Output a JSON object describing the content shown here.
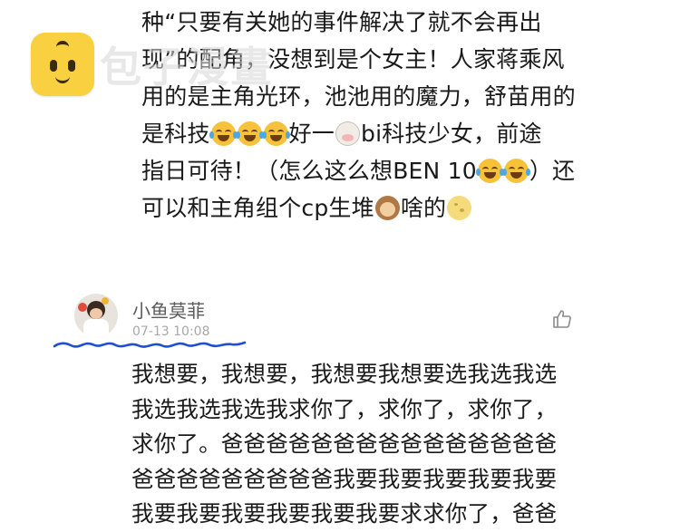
{
  "previous_comment": {
    "lines": [
      "种“只要有关她的事件解决了就不会再出",
      "现”的配角，没想到是个女主！人家蒋乘风",
      "用的是主角光环，池池用的魔力，舒苗用的",
      "是科技",
      "好一",
      "bi科技少女，前途",
      "指日可待！（怎么这么想BEN 10",
      "）还",
      "可以和主角组个cp生堆",
      "啥的"
    ],
    "emojis": [
      "laugh-crying-emoji",
      "cow-emoji",
      "monkey-emoji",
      "moon-emoji"
    ]
  },
  "watermark": {
    "text": "包子漫畫",
    "logo_color": "#f9d03f",
    "icon": "bun-mascot-icon"
  },
  "comment": {
    "username": "小鱼莫菲",
    "timestamp": "07-13 10:08",
    "like_icon": "thumbs-up-icon",
    "lines": [
      "我想要，我想要，我想要我想要选我选我选",
      "我选我选我选我求你了，求你了，求你了，",
      "求你了。爸爸爸爸爸爸爸爸爸爸爸爸爸爸爸",
      "爸爸爸爸爸爸爸爸爸我要我要我要我要我要",
      "我要我要我要我要我要我要求求你了，爸爸"
    ]
  },
  "colors": {
    "text": "#1a1a1a",
    "username": "#5a5a5a",
    "timestamp": "#a8a8a8",
    "scribble": "#1f4fd0"
  }
}
